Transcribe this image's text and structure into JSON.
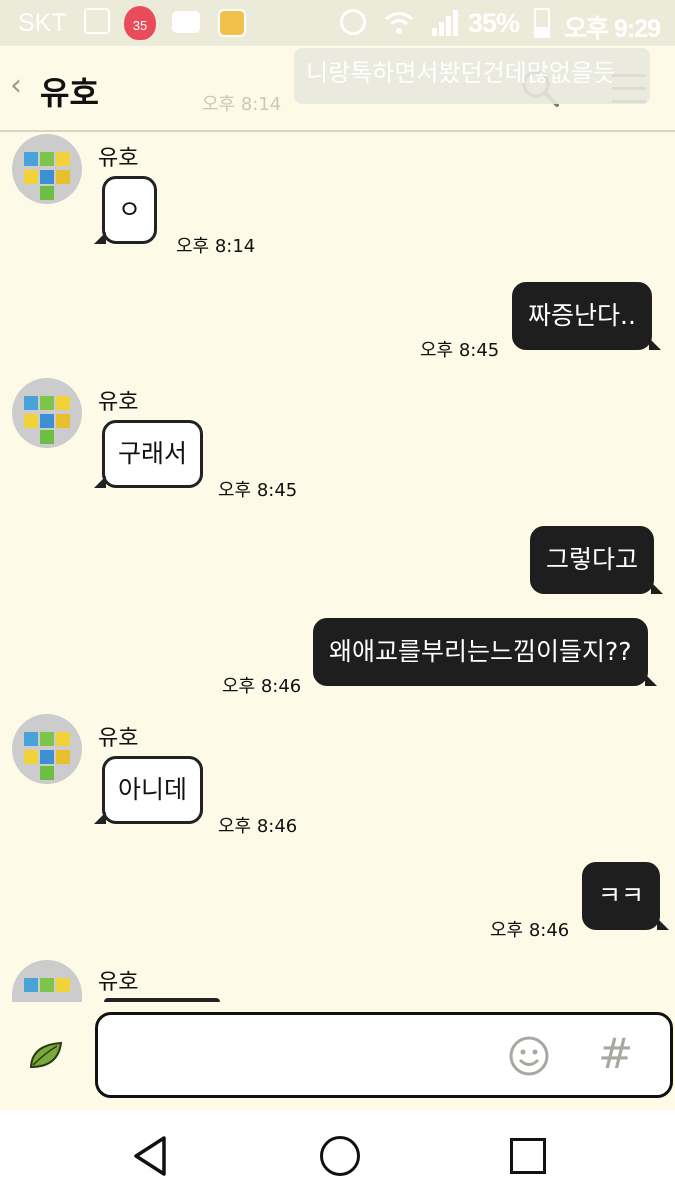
{
  "status_bar": {
    "carrier": "SKT",
    "battery": "35%",
    "time": "오후 9:29",
    "strawberry_count": "35"
  },
  "header": {
    "back_glyph": "‹",
    "title": "유호"
  },
  "notification": {
    "preview": "니랑톡하면서봤던건데많없을듯",
    "time": "오후 8:14"
  },
  "messages": [
    {
      "dir": "in",
      "sender": "유호",
      "text": "ㅇ",
      "time": "오후 8:14"
    },
    {
      "dir": "out",
      "text": "짜증난다..",
      "time": "오후 8:45"
    },
    {
      "dir": "in",
      "sender": "유호",
      "text": "구래서",
      "time": "오후 8:45"
    },
    {
      "dir": "out",
      "text": "그렇다고",
      "time": ""
    },
    {
      "dir": "out",
      "text": "왜애교를부리는느낌이들지??",
      "time": "오후 8:46"
    },
    {
      "dir": "in",
      "sender": "유호",
      "text": "아니데",
      "time": "오후 8:46"
    },
    {
      "dir": "out",
      "text": "ㅋㅋ",
      "time": "오후 8:46"
    },
    {
      "dir": "in",
      "sender": "유호",
      "text": "",
      "time": ""
    }
  ],
  "input": {
    "placeholder": "",
    "hash_glyph": "#"
  },
  "colors": {
    "background": "#fdfbe8",
    "out_bubble": "#1e1e1e",
    "in_bubble": "#ffffff"
  }
}
